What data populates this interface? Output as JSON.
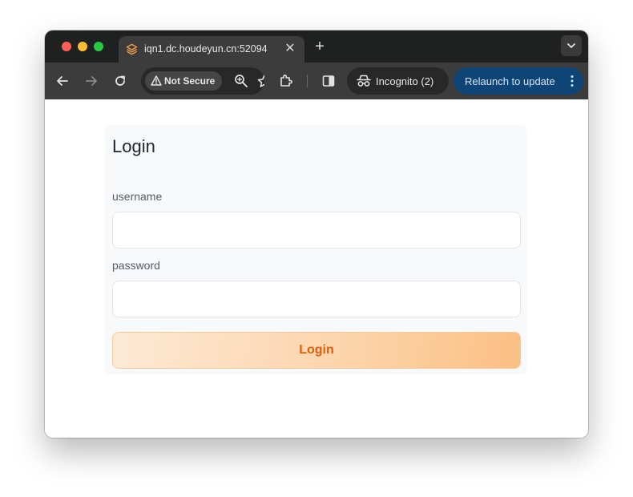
{
  "browser": {
    "tab_title": "iqn1.dc.houdeyun.cn:52094",
    "tab_close_glyph": "✕",
    "new_tab_glyph": "+",
    "security_label": "Not Secure",
    "incognito_label": "Incognito (2)",
    "relaunch_label": "Relaunch to update",
    "icons": [
      "back-icon",
      "forward-icon",
      "reload-icon",
      "warning-icon",
      "zoom-icon",
      "bookmark-star-icon",
      "extensions-icon",
      "side-panel-icon",
      "incognito-icon",
      "kebab-menu-icon",
      "tab-search-icon",
      "favicon-icon"
    ]
  },
  "login": {
    "title": "Login",
    "username_label": "username",
    "username_value": "",
    "password_label": "password",
    "password_value": "",
    "submit_label": "Login"
  },
  "colors": {
    "button_text": "#e35d0f",
    "button_gradient_start": "#fde9d6",
    "button_gradient_end": "#fbbf83",
    "relaunch_bg": "#0f4476"
  }
}
